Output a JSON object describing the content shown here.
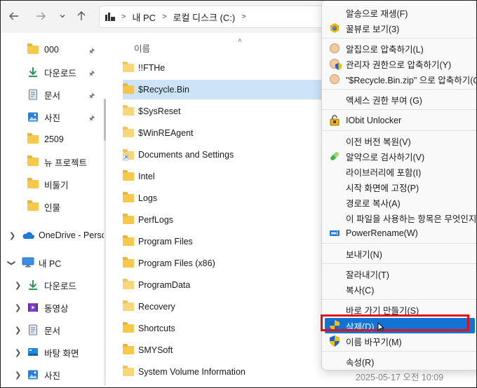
{
  "toolbar": {
    "back_icon": "back-arrow-icon",
    "forward_icon": "forward-arrow-icon",
    "recent_icon": "chevron-down-icon",
    "up_icon": "up-arrow-icon",
    "breadcrumb": [
      "내 PC",
      "로컬 디스크 (C:)"
    ]
  },
  "sidebar": {
    "quick_access": [
      {
        "label": "000",
        "icon": "folder-icon",
        "pinned": true
      },
      {
        "label": "다운로드",
        "icon": "download-icon",
        "pinned": true
      },
      {
        "label": "문서",
        "icon": "document-icon",
        "pinned": true
      },
      {
        "label": "사진",
        "icon": "picture-icon",
        "pinned": true
      },
      {
        "label": "2509",
        "icon": "folder-icon",
        "pinned": false
      },
      {
        "label": "뉴 프로젝트",
        "icon": "folder-icon",
        "pinned": false
      },
      {
        "label": "비둘기",
        "icon": "folder-icon",
        "pinned": false
      },
      {
        "label": "인물",
        "icon": "folder-icon",
        "pinned": false
      }
    ],
    "onedrive_label": "OneDrive - Perso",
    "this_pc_label": "내 PC",
    "this_pc_children": [
      {
        "label": "다운로드",
        "icon": "download-icon"
      },
      {
        "label": "동영상",
        "icon": "video-icon"
      },
      {
        "label": "문서",
        "icon": "document-icon"
      },
      {
        "label": "바탕 화면",
        "icon": "desktop-icon"
      },
      {
        "label": "사진",
        "icon": "picture-icon"
      }
    ]
  },
  "file_list": {
    "column_name": "이름",
    "items": [
      {
        "name": "!!FTHe",
        "selected": false
      },
      {
        "name": "$Recycle.Bin",
        "selected": true
      },
      {
        "name": "$SysReset",
        "selected": false
      },
      {
        "name": "$WinREAgent",
        "selected": false
      },
      {
        "name": "Documents and Settings",
        "selected": false
      },
      {
        "name": "Intel",
        "selected": false
      },
      {
        "name": "Logs",
        "selected": false
      },
      {
        "name": "PerfLogs",
        "selected": false
      },
      {
        "name": "Program Files",
        "selected": false
      },
      {
        "name": "Program Files (x86)",
        "selected": false
      },
      {
        "name": "ProgramData",
        "selected": false
      },
      {
        "name": "Recovery",
        "selected": false
      },
      {
        "name": "Shortcuts",
        "selected": false
      },
      {
        "name": "SMYSoft",
        "selected": false
      },
      {
        "name": "System Volume Information",
        "selected": false
      }
    ],
    "partial_date": "2025-05-17 오전 10:09"
  },
  "context_menu": {
    "groups": [
      [
        {
          "label": "알송으로 재생(F)",
          "icon": ""
        },
        {
          "label": "꿀뷰로 보기(3)",
          "icon": "honeyview-icon"
        }
      ],
      [
        {
          "label": "알집으로 압축하기(L)",
          "icon": "alzip-icon"
        },
        {
          "label": "관리자 권한으로 압축하기(Y)",
          "icon": "alzip-admin-icon"
        },
        {
          "label": "\"$Recycle.Bin.zip\" 으로 압축하기(Q",
          "icon": "alzip-icon"
        }
      ],
      [
        {
          "label": "액세스 권한 부여 (G)",
          "icon": ""
        }
      ],
      [
        {
          "label": "IObit Unlocker",
          "icon": "unlock-icon"
        }
      ],
      [
        {
          "label": "이전 버전 복원(V)",
          "icon": ""
        },
        {
          "label": "알약으로 검사하기(V)",
          "icon": "alyac-pill-icon"
        },
        {
          "label": "라이브러리에 포함(I)",
          "icon": ""
        },
        {
          "label": "시작 화면에 고정(P)",
          "icon": ""
        },
        {
          "label": "경로로 복사(A)",
          "icon": ""
        },
        {
          "label": "이 파일을 사용하는 항목은 무엇인지",
          "icon": ""
        },
        {
          "label": "PowerRename(W)",
          "icon": "powerrename-icon"
        }
      ],
      [
        {
          "label": "보내기(N)",
          "icon": ""
        }
      ],
      [
        {
          "label": "잘라내기(T)",
          "icon": ""
        },
        {
          "label": "복사(C)",
          "icon": ""
        }
      ],
      [
        {
          "label": "바로 가기 만들기(S)",
          "icon": ""
        },
        {
          "label": "삭제(D)",
          "icon": "shield-uac-icon",
          "highlighted": true
        },
        {
          "label": "이름 바꾸기(M)",
          "icon": "shield-uac-icon"
        }
      ],
      [
        {
          "label": "속성(R)",
          "icon": ""
        }
      ]
    ]
  },
  "colors": {
    "accent": "#1273d3",
    "selection": "#cce4f7",
    "highlight_box": "#e0111b",
    "folder": "#f6c84c"
  }
}
